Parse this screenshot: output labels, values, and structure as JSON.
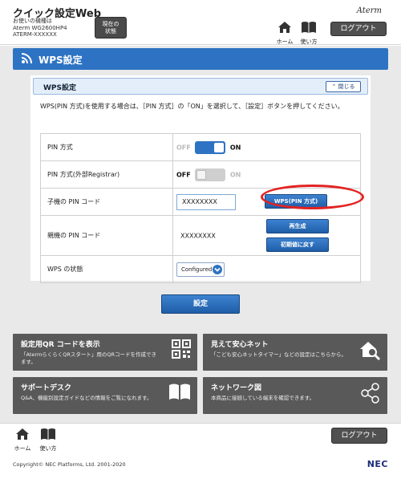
{
  "header": {
    "title": "クイック設定Web",
    "device_line1": "お使いの機種は",
    "device_line2": "Aterm WG2600HP4",
    "device_line3": "ATERM-XXXXXX",
    "status_button_line1": "現在の",
    "status_button_line2": "状態",
    "brand": "Aterm",
    "home_label": "ホーム",
    "help_label": "使い方",
    "logout_label": "ログアウト"
  },
  "banner": {
    "title": "WPS設定"
  },
  "section": {
    "title": "WPS設定",
    "close_label": "閉じる",
    "description": "WPS(PIN 方式)を使用する場合は、［PIN 方式］の「ON」を選択して、［設定］ボタンを押してください。"
  },
  "rows": {
    "pin_method": {
      "label": "PIN 方式",
      "off": "OFF",
      "on": "ON",
      "state": "on"
    },
    "pin_external": {
      "label": "PIN 方式(外部Registrar)",
      "off": "OFF",
      "on": "ON",
      "state": "off"
    },
    "child_pin": {
      "label": "子機の PIN コード",
      "value": "XXXXXXXX",
      "button": "WPS(PIN 方式)"
    },
    "parent_pin": {
      "label": "親機の PIN コード",
      "value": "XXXXXXXX",
      "regen_button": "再生成",
      "reset_button": "初期値に戻す"
    },
    "wps_status": {
      "label": "WPS の状態",
      "selected": "Configured"
    }
  },
  "apply_label": "設定",
  "tiles": [
    {
      "title": "設定用QR コードを表示",
      "desc": "「AtermらくらくQRスタート」用のQRコードを作成できます。"
    },
    {
      "title": "見えて安心ネット",
      "desc": "「こども安心ネットタイマー」などの設定はこちらから。"
    },
    {
      "title": "サポートデスク",
      "desc": "Q&A、機能別設定ガイドなどの情報をご覧になれます。"
    },
    {
      "title": "ネットワーク図",
      "desc": "本商品に接続している端末を確認できます。"
    }
  ],
  "footer": {
    "home_label": "ホーム",
    "help_label": "使い方",
    "logout_label": "ログアウト",
    "copyright": "Copyright© NEC Platforms, Ltd. 2001-2020",
    "logo": "NEC"
  },
  "colors": {
    "accent": "#2e73c3",
    "highlight": "#e32222",
    "tile": "#595959",
    "dark_button": "#505050"
  },
  "icons": [
    "wifi-icon",
    "home-icon",
    "book-icon",
    "qr-code-icon",
    "magnifier-house-icon",
    "open-book-icon",
    "network-share-icon",
    "chevron-down-icon"
  ]
}
